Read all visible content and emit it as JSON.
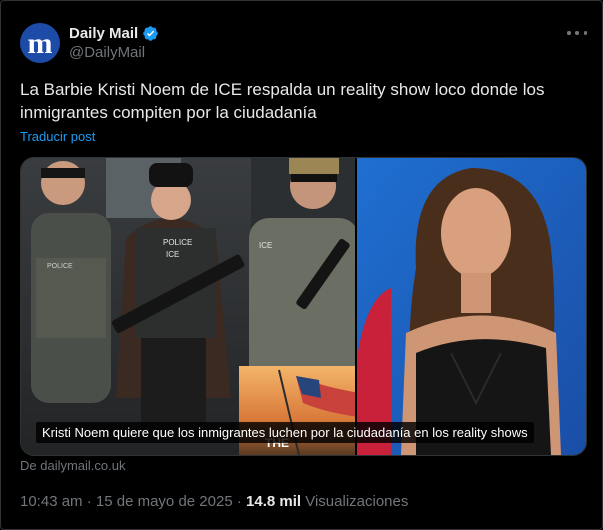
{
  "author": {
    "display_name": "Daily Mail",
    "handle": "@DailyMail",
    "avatar_letter": "m",
    "avatar_color": "#1d4ba8",
    "verified_color": "#1d9bf0"
  },
  "post": {
    "text": "La Barbie Kristi Noem de ICE respalda un reality show loco donde los inmigrantes compiten por la ciudadanía",
    "translate_label": "Traducir post"
  },
  "card": {
    "caption": "Kristi Noem quiere que los inmigrantes luchen por la ciudadanía en los reality shows",
    "source": "De dailymail.co.uk",
    "patch_text_left": "POLICE",
    "patch_text_right": "ICE",
    "patch_text_side": "ICE",
    "patch_text_vest": "POLICE",
    "overlay_text": "THE"
  },
  "meta": {
    "time": "10:43 am",
    "separator": "·",
    "date": "15 de mayo de 2025",
    "views_count": "14.8 mil",
    "views_label": "Visualizaciones"
  },
  "icons": {
    "verified": "verified-badge-icon",
    "more": "more-options-icon"
  }
}
